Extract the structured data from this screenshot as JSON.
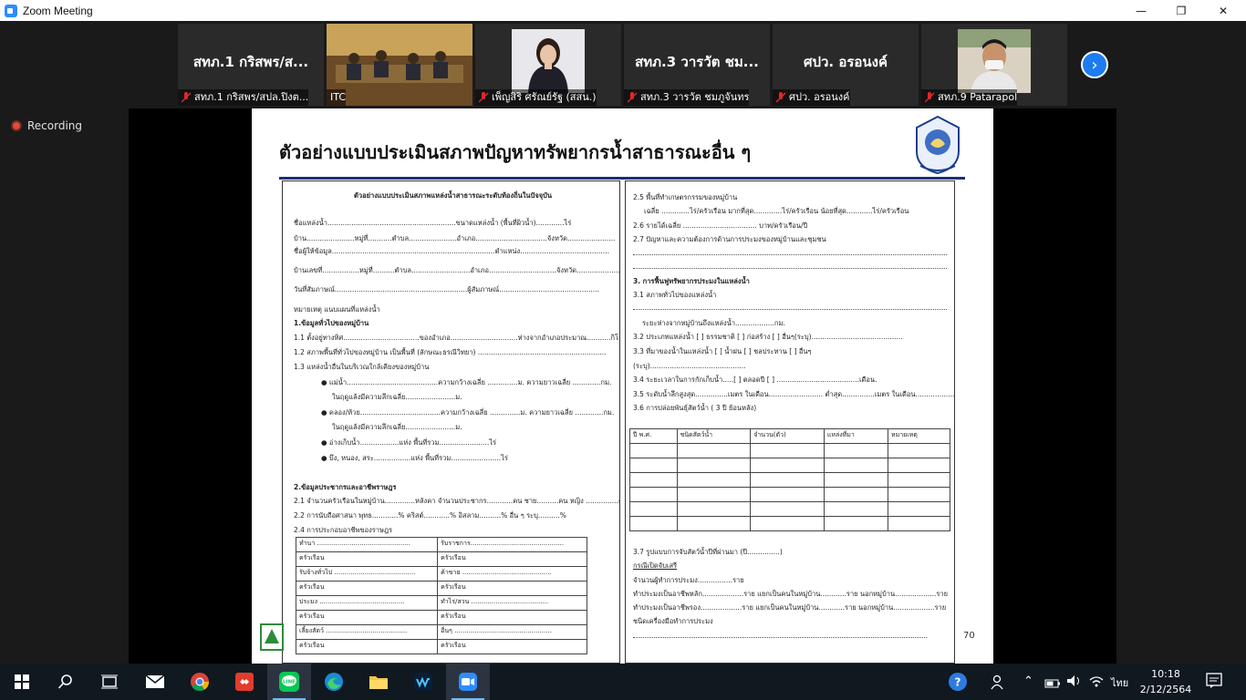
{
  "window": {
    "title": "Zoom Meeting",
    "minimize": "—",
    "restore": "❐",
    "close": "✕"
  },
  "participants": [
    {
      "big": "สทภ.1 กริสพร/ส...",
      "label": "สทภ.1 กริสพร/สปล.ปิงต..."
    },
    {
      "big": "",
      "label": "ITC"
    },
    {
      "big": "",
      "label": "เพ็ญสิริ ศรัณย์รัฐ (สสน.)"
    },
    {
      "big": "สทภ.3 วารวัต ชม...",
      "label": "สทภ.3 วารวัต ชมภูจันทร"
    },
    {
      "big": "ศปว. อรอนงค์",
      "label": "ศปว. อรอนงค์"
    },
    {
      "big": "",
      "label": "สทภ.9 Patarapol"
    }
  ],
  "recording": "Recording",
  "slide": {
    "title": "ตัวอย่างแบบประเมินสภาพปัญหาทรัพยากรน้ำสาธารณะอื่น ๆ",
    "page_number": "70",
    "left": {
      "heading": "ตัวอย่างแบบประเมินสภาพแหล่งน้ำสาธารณะระดับท้องถิ่นในปัจจุบัน",
      "lines": [
        "ชื่อแหล่งน้ำ...........................................................ขนาดแหล่งน้ำ (พื้นที่ผิวน้ำ).............ไร่",
        "บ้าน......................หมู่ที่...........ตำบล......................อำเภอ.................................จังหวัด......................",
        "ชื่อผู้ให้ข้อมูล...........................................................................ตำแหน่ง.........................................",
        "บ้านเลขที่.................หมู่ที่..........ตำบล...........................อำเภอ...............................จังหวัด.........................",
        "วันที่สัมภาษณ์.............................................................ผู้สัมภาษณ์..............................................",
        "หมายเหตุ  แนบแผนที่แหล่งน้ำ",
        "1.ข้อมูลทั่วไปของหมู่บ้าน",
        "1.1 ตั้งอยู่ทางทิศ...................................ของอำเภอ...............................ห่างจากอำเภอประมาณ...........กิโลเมตร",
        "1.2 สภาพพื้นที่ทั่วไปของหมู่บ้าน เป็นพื้นที่ (ลักษณะธรณีวิทยา) ...........................................................",
        "1.3 แหล่งน้ำอื่นในบริเวณใกล้เคียงของหมู่บ้าน",
        "●  แม่น้ำ..........................................ความกว้างเฉลี่ย ..............ม. ความยาวเฉลี่ย .............กม.",
        "ในฤดูแล้งมีความลึกเฉลี่ย.......................ม.",
        "●  คลอง/ห้วย.....................................ความกว้างเฉลี่ย ..............ม. ความยาวเฉลี่ย .............กม.",
        "ในฤดูแล้งมีความลึกเฉลี่ย.......................ม.",
        "●  อ่างเก็บน้ำ..................แห่ง พื้นที่รวม.......................ไร่",
        "●  บึง, หนอง, สระ.................แห่ง พื้นที่รวม.......................ไร่",
        "2.ข้อมูลประชากรและอาชีพราษฎร",
        "2.1 จำนวนครัวเรือนในหมู่บ้าน..............หลังคา  จำนวนประชากร............คน ชาย..........คน หญิง ...............คน",
        "2.2 การนับถือศาสนา  พุทธ............%     คริสต์............%          อิสลาม..........%      อื่น ๆ ระบุ..........%",
        "2.4 การประกอบอาชีพของราษฎร"
      ],
      "occupations": [
        [
          "ทำนา ..............................................",
          "รับราชการ.............................................."
        ],
        [
          "ครัวเรือน",
          "ครัวเรือน"
        ],
        [
          "รับจ้างทั่วไป ........................................",
          "ค้าขาย ............................................"
        ],
        [
          "ครัวเรือน",
          "ครัวเรือน"
        ],
        [
          "ประมง ..........................................",
          "ทำไร่/สวน ......................................"
        ],
        [
          "ครัวเรือน",
          "ครัวเรือน"
        ],
        [
          "เลี้ยงสัตว์ ........................................",
          "อื่นๆ ................................................"
        ],
        [
          "ครัวเรือน",
          "ครัวเรือน"
        ]
      ]
    },
    "right": {
      "lines": [
        "2.5 พื้นที่ทำเกษตรกรรมของหมู่บ้าน",
        "เฉลี่ย .............ไร่/ครัวเรือน          มากที่สุด.............ไร่/ครัวเรือน          น้อยที่สุด............ไร่/ครัวเรือน",
        "2.6 รายได้เฉลี่ย .................................. บาท/ครัวเรือน/ปี",
        "2.7 ปัญหาและความต้องการด้านการประมงของหมู่บ้านและชุมชน",
        "3. การฟื้นฟูทรัพยากรประมงในแหล่งน้ำ",
        "3.1 สภาพทั่วไปของแหล่งน้ำ",
        "ระยะห่างจากหมู่บ้านถึงแหล่งน้ำ..................กม.",
        "3.2 ประเภทแหล่งน้ำ    [ ] ธรรมชาติ  [ ] ก่อสร้าง        [ ] อื่นๆ(ระบุ)..........................................",
        "3.3 ที่มาของน้ำในแหล่งน้ำ     [ ] น้ำฝน     [ ] ชลประทาน            [ ] อื่นๆ",
        "(ระบุ)............................................",
        "3.4 ระยะเวลาในการกักเก็บน้ำ.....[ ] ตลอดปี              [ ] ......................................เดือน.",
        "3.5 ระดับน้ำลึกสูงสุด...............เมตร ในเดือน.........................  ต่ำสุด...............เมตร ในเดือน..................",
        "3.6 การปล่อยพันธุ์สัตว์น้ำ ( 3 ปี ย้อนหลัง)",
        "3.7 รูปแบบการจับสัตว์น้ำปีที่ผ่านมา (ปี...............)",
        "กรณีเปิดจับเสรี",
        "จำนวนผู้ทำการประมง................ราย",
        "ทำประมงเป็นอาชีพหลัก...................ราย  แยกเป็นคนในหมู่บ้าน............ราย นอกหมู่บ้าน...................ราย",
        "ทำประมงเป็นอาชีพรอง...................ราย  แยกเป็นคนในหมู่บ้าน............ราย นอกหมู่บ้าน...................ราย",
        "ชนิดเครื่องมือทำการประมง"
      ],
      "release_headers": [
        "ปี พ.ศ.",
        "ชนิดสัตว์น้ำ",
        "จำนวน(ตัว)",
        "แหล่งที่มา",
        "หมายเหตุ"
      ]
    }
  },
  "taskbar": {
    "time": "10:18",
    "date": "2/12/2564",
    "lang": "ไทย"
  },
  "colors": {
    "zoom_blue": "#2d8cff",
    "active_speaker": "#d6c400",
    "mic_muted": "#e02828",
    "slide_rule": "#1a2f7a"
  }
}
